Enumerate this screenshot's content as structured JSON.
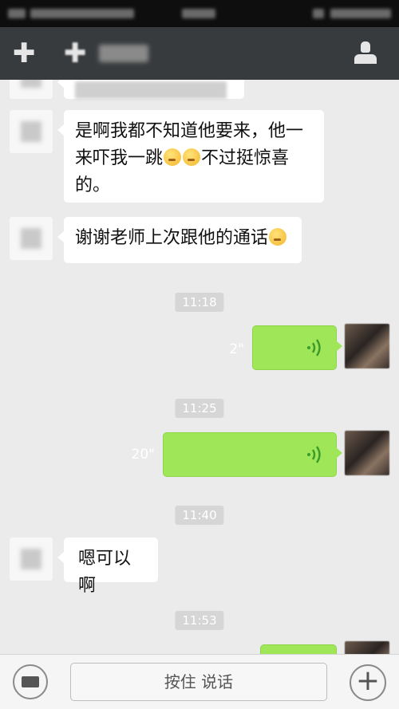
{
  "input_bar": {
    "press_to_talk_label": "按住 说话",
    "plus_icon": "+"
  },
  "messages": {
    "m1_text_line1": "是啊我都不知道他要来，他一",
    "m1_text_line2": "来吓我一跳",
    "m1_text_line2b": "不过挺惊喜",
    "m1_text_line3": "的。",
    "m2_text": "谢谢老师上次跟他的通话",
    "m3_text": "嗯可以啊"
  },
  "timestamps": {
    "t1": "11:18",
    "t2": "11:25",
    "t3": "11:40",
    "t4": "11:53"
  },
  "voice": {
    "v1_duration": "2\"",
    "v2_duration": "20\""
  },
  "colors": {
    "sent_bubble": "#9fe658",
    "received_bubble": "#ffffff",
    "title_bar": "#383b3e",
    "chat_bg": "#ebebeb"
  }
}
